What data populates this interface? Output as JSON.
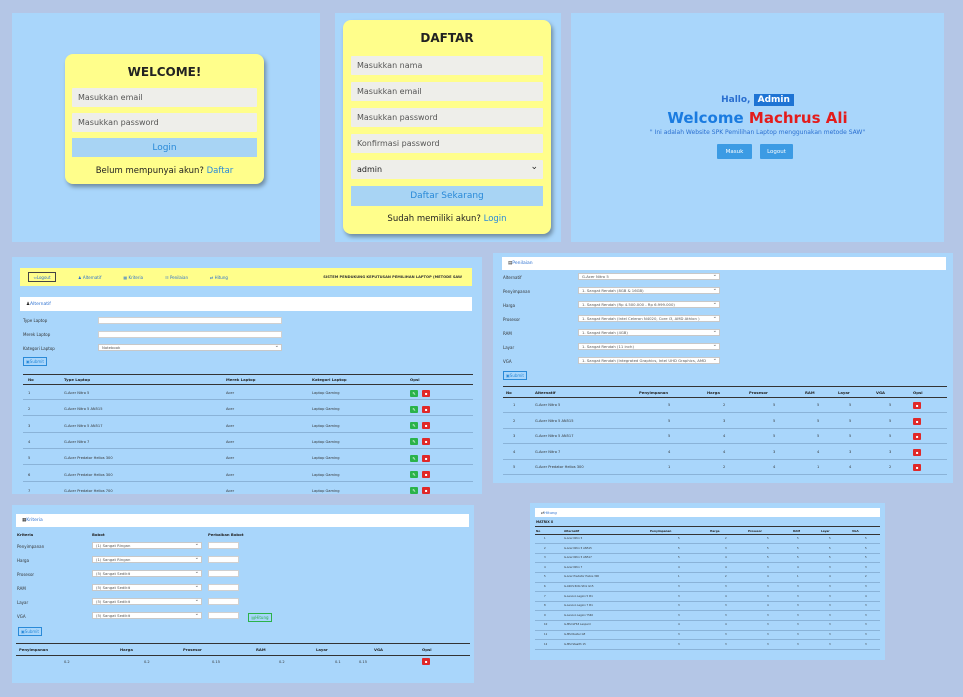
{
  "login": {
    "title": "WELCOME!",
    "email_placeholder": "Masukkan email",
    "password_placeholder": "Masukkan password",
    "login_button": "Login",
    "no_account_text": "Belum mempunyai akun?",
    "register_link": "Daftar"
  },
  "register": {
    "title": "DAFTAR",
    "name_placeholder": "Masukkan nama",
    "email_placeholder": "Masukkan email",
    "password_placeholder": "Masukkan password",
    "confirm_placeholder": "Konfirmasi password",
    "role_value": "admin",
    "register_button": "Daftar Sekarang",
    "has_account_text": "Sudah memiliki akun?",
    "login_link": "Login"
  },
  "home": {
    "hallo": "Hallo,",
    "role": "Admin",
    "welcome": "Welcome",
    "user_name": "Machrus Ali",
    "tagline": "\" Ini adalah Website SPK Pemilihan Laptop menggunakan metode SAW\"",
    "masuk_button": "Masuk",
    "logout_button": "Logout"
  },
  "nav": {
    "logout": "Logout",
    "items": [
      "Alternatif",
      "Kriteria",
      "Penilaian",
      "Hitung"
    ],
    "system_title": "SISTEM PENDUKUNG KEPUTUSAN PEMILIHAN LAPTOP (METODE SAW"
  },
  "alternatif": {
    "section_title": "Alternatif",
    "label_type": "Type Laptop",
    "label_brand": "Merek Laptop",
    "label_category": "Kategori Laptop",
    "category_value": "Notebook",
    "submit": "Submit",
    "headers": [
      "No",
      "Type Laptop",
      "Merek Laptop",
      "Kategori Laptop",
      "Opsi"
    ],
    "rows": [
      [
        "1",
        "G-Acer Nitro 5",
        "Acer",
        "Laptop Gaming"
      ],
      [
        "2",
        "G-Acer Nitro 5 AN515",
        "Acer",
        "Laptop Gaming"
      ],
      [
        "3",
        "G-Acer Nitro 5 AN517",
        "Acer",
        "Laptop Gaming"
      ],
      [
        "4",
        "G-Acer Nitro 7",
        "Acer",
        "Laptop Gaming"
      ],
      [
        "5",
        "G-Acer Predator Helios 300",
        "Acer",
        "Laptop Gaming"
      ],
      [
        "6",
        "G-Acer Predator Helios 300",
        "Acer",
        "Laptop Gaming"
      ],
      [
        "7",
        "G-Acer Predator Helios 700",
        "Acer",
        "Laptop Gaming"
      ]
    ]
  },
  "penilaian": {
    "section_title": "Penilaian",
    "fields": [
      {
        "label": "Alternatif",
        "value": "G-Acer Nitro 5"
      },
      {
        "label": "Penyimpanan",
        "value": "1. Sangat Rendah (8GB & 16GB)"
      },
      {
        "label": "Harga",
        "value": "1. Sangat Rendah (Rp 4.500.000 - Rp 6.999.000)"
      },
      {
        "label": "Prosesor",
        "value": "1. Sangat Rendah (Intel Celeron N4020, Core i3, AMD Athlon )"
      },
      {
        "label": "RAM",
        "value": "1. Sangat Rendah (4GB)"
      },
      {
        "label": "Layar",
        "value": "1. Sangat Rendah (11 inch)"
      },
      {
        "label": "VGA",
        "value": "1. Sangat Rendah (Integrated Graphics, Intel UHD Graphics, AMD"
      }
    ],
    "submit": "Submit",
    "headers": [
      "No",
      "Alternatif",
      "Penyimpanan",
      "Harga",
      "Prosesor",
      "RAM",
      "Layar",
      "VGA",
      "Opsi"
    ],
    "rows": [
      [
        "1",
        "G-Acer Nitro 5",
        "5",
        "2",
        "5",
        "5",
        "5",
        "5"
      ],
      [
        "2",
        "G-Acer Nitro 5 AN515",
        "5",
        "3",
        "5",
        "5",
        "5",
        "5"
      ],
      [
        "3",
        "G-Acer Nitro 5 AN517",
        "5",
        "4",
        "5",
        "5",
        "5",
        "5"
      ],
      [
        "4",
        "G-Acer Nitro 7",
        "4",
        "4",
        "3",
        "4",
        "3",
        "3"
      ],
      [
        "5",
        "G-Acer Predator Helios 300",
        "1",
        "2",
        "4",
        "1",
        "4",
        "2"
      ]
    ]
  },
  "kriteria": {
    "section_title": "Kriteria",
    "col_kriteria": "Kriteria",
    "col_bobot": "Bobot",
    "col_perbaikan": "Perbaikan Bobot",
    "rows": [
      {
        "label": "Penyimpanan",
        "value": "(1) Sangat Ringan"
      },
      {
        "label": "Harga",
        "value": "(1) Sangat Ringan"
      },
      {
        "label": "Prosesor",
        "value": "(5) Sangat Sedikit"
      },
      {
        "label": "RAM",
        "value": "(5) Sangat Sedikit"
      },
      {
        "label": "Layar",
        "value": "(5) Sangat Sedikit"
      },
      {
        "label": "VGA",
        "value": "(5) Sangat Sedikit"
      }
    ],
    "hitung_button": "Hitung",
    "submit": "Submit",
    "headers": [
      "Penyimpanan",
      "Harga",
      "Prosesor",
      "RAM",
      "Layar",
      "VGA",
      "Opsi"
    ],
    "values": [
      "0.2",
      "0.2",
      "0.15",
      "0.2",
      "0.1",
      "0.15"
    ]
  },
  "hitung": {
    "section_title": "Hitung",
    "matrix_label": "MATRIX X",
    "headers": [
      "No",
      "Alternatif",
      "Penyimpanan",
      "Harga",
      "Prosesor",
      "RAM",
      "Layar",
      "VGA"
    ],
    "rows": [
      [
        "1",
        "G-Acer Nitro 5",
        "5",
        "2",
        "5",
        "5",
        "5",
        "5"
      ],
      [
        "2",
        "G-Acer Nitro 5 AN515",
        "5",
        "3",
        "5",
        "5",
        "5",
        "5"
      ],
      [
        "3",
        "G-Acer Nitro 5 AN517",
        "5",
        "4",
        "5",
        "5",
        "5",
        "5"
      ],
      [
        "4",
        "G-Acer Nitro 7",
        "4",
        "4",
        "3",
        "4",
        "3",
        "3"
      ],
      [
        "5",
        "G-Acer Predator Helios 300",
        "1",
        "2",
        "4",
        "1",
        "4",
        "2"
      ],
      [
        "6",
        "G-ASUS ROG Strix G15",
        "3",
        "3",
        "3",
        "3",
        "3",
        "3"
      ],
      [
        "7",
        "G-Lenovo Legion 5 Pro",
        "3",
        "4",
        "3",
        "3",
        "3",
        "4"
      ],
      [
        "8",
        "G-Lenovo Legion 7 Pro",
        "3",
        "3",
        "4",
        "3",
        "3",
        "3"
      ],
      [
        "9",
        "G-Lenovo Legion Y540",
        "3",
        "3",
        "3",
        "3",
        "3",
        "3"
      ],
      [
        "10",
        "G-MSI GF63 Leopard",
        "4",
        "4",
        "3",
        "3",
        "3",
        "3"
      ],
      [
        "11",
        "G-MSI Raider GE",
        "3",
        "3",
        "3",
        "3",
        "3",
        "3"
      ],
      [
        "12",
        "G-MSI Stealth 15",
        "3",
        "3",
        "3",
        "3",
        "3",
        "3"
      ]
    ]
  }
}
